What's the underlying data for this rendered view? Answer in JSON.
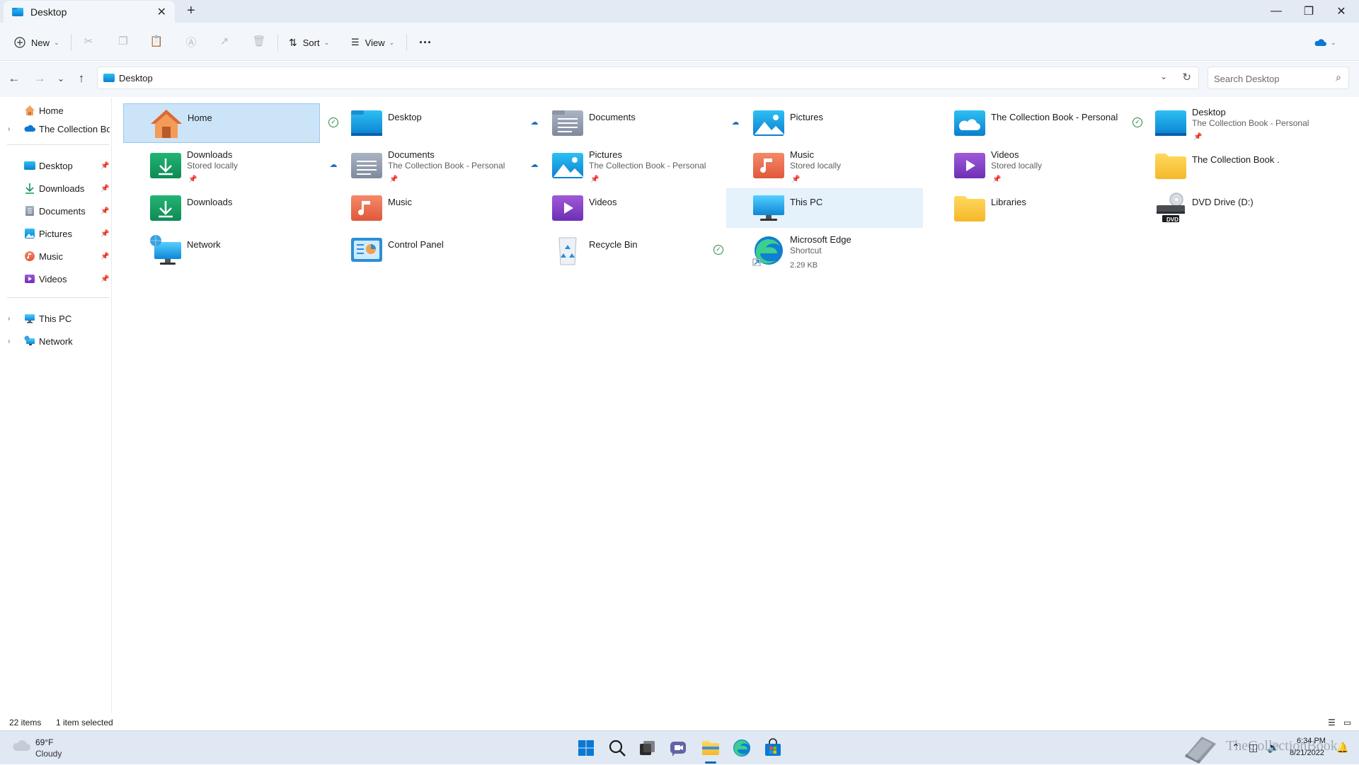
{
  "window": {
    "tab_title": "Desktop",
    "tab_close": "✕",
    "new_tab": "+",
    "minimize": "—",
    "maximize": "❐",
    "close": "✕"
  },
  "toolbar": {
    "new_label": "New",
    "sort_label": "Sort",
    "view_label": "View",
    "more_label": "···"
  },
  "address": {
    "path": "Desktop",
    "search_placeholder": "Search Desktop"
  },
  "sidebar": {
    "home": "Home",
    "onedrive": "The Collection Boo",
    "quick": [
      {
        "label": "Desktop"
      },
      {
        "label": "Downloads"
      },
      {
        "label": "Documents"
      },
      {
        "label": "Pictures"
      },
      {
        "label": "Music"
      },
      {
        "label": "Videos"
      }
    ],
    "this_pc": "This PC",
    "network": "Network"
  },
  "items": {
    "home": {
      "name": "Home"
    },
    "desktop": {
      "name": "Desktop"
    },
    "documents": {
      "name": "Documents"
    },
    "pictures": {
      "name": "Pictures"
    },
    "collection_book": {
      "name": "The Collection Book - Personal"
    },
    "desktop_personal": {
      "name": "Desktop",
      "sub": "The Collection Book - Personal"
    },
    "downloads_local": {
      "name": "Downloads",
      "sub": "Stored locally"
    },
    "documents_personal": {
      "name": "Documents",
      "sub": "The Collection Book - Personal"
    },
    "pictures_personal": {
      "name": "Pictures",
      "sub": "The Collection Book - Personal"
    },
    "music_local": {
      "name": "Music",
      "sub": "Stored locally"
    },
    "videos_local": {
      "name": "Videos",
      "sub": "Stored locally"
    },
    "collection_book_folder": {
      "name": "The Collection Book ."
    },
    "downloads": {
      "name": "Downloads"
    },
    "music": {
      "name": "Music"
    },
    "videos": {
      "name": "Videos"
    },
    "this_pc": {
      "name": "This PC"
    },
    "libraries": {
      "name": "Libraries"
    },
    "dvd": {
      "name": "DVD Drive (D:)",
      "badge": "DVD"
    },
    "network": {
      "name": "Network"
    },
    "control_panel": {
      "name": "Control Panel"
    },
    "recycle_bin": {
      "name": "Recycle Bin"
    },
    "edge": {
      "name": "Microsoft Edge",
      "sub": "Shortcut",
      "size": "2.29 KB"
    }
  },
  "status_bar": {
    "count": "22 items",
    "selection": "1 item selected"
  },
  "taskbar": {
    "temperature": "69°F",
    "condition": "Cloudy",
    "time": "6:34 PM",
    "date": "8/21/2022"
  },
  "watermark": {
    "text": "TheCollectionBook"
  },
  "colors": {
    "accent": "#0067c0",
    "selection": "#cce4f7",
    "hover": "#e5f1fb",
    "synced": "#2b8a3e",
    "cloud": "#1f6fc1"
  }
}
